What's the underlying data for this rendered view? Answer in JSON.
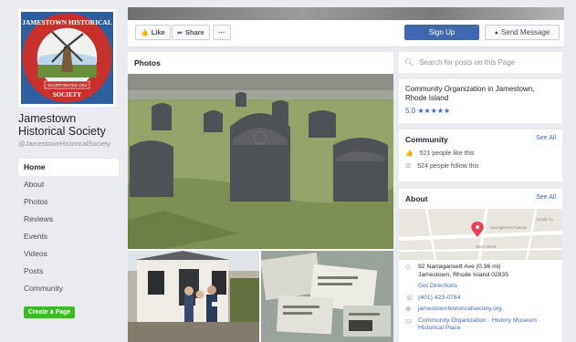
{
  "page": {
    "name": "Jamestown Historical Society",
    "handle": "@JamestownHistoricalSociety",
    "logo_text_top": "JAMESTOWN HISTORICAL",
    "logo_text_bottom": "SOCIETY",
    "logo_incorporated": "INCORPORATED 1912"
  },
  "nav": {
    "items": [
      "Home",
      "About",
      "Photos",
      "Reviews",
      "Events",
      "Videos",
      "Posts",
      "Community"
    ],
    "active": "Home",
    "create_page": "Create a Page"
  },
  "actions": {
    "like": "Like",
    "share": "Share",
    "more": "···",
    "sign_up": "Sign Up",
    "send_message": "Send Message"
  },
  "photos": {
    "title": "Photos"
  },
  "search": {
    "placeholder": "Search for posts on this Page"
  },
  "info": {
    "category": "Community Organization in Jamestown, Rhode Island",
    "rating": "5.0",
    "stars": "★★★★★"
  },
  "community": {
    "title": "Community",
    "see_all": "See All",
    "likes": "521 people like this",
    "follows": "524 people follow this"
  },
  "about": {
    "title": "About",
    "see_all": "See All",
    "map_streets": [
      "Narragansett Avenue",
      "West Street",
      "Arnold Cv"
    ],
    "address_line1": "92 Narragansett Ave (0.36 mi)",
    "address_line2": "Jamestown, Rhode Island 02835",
    "directions": "Get Directions",
    "phone": "(401) 423-0784",
    "website": "jamestownhistoricalsociety.org",
    "categories": "Community Organization · History Museum · Historical Place"
  },
  "colors": {
    "brand": "#4267b2",
    "green": "#42b72a",
    "bg": "#e9ebee"
  }
}
